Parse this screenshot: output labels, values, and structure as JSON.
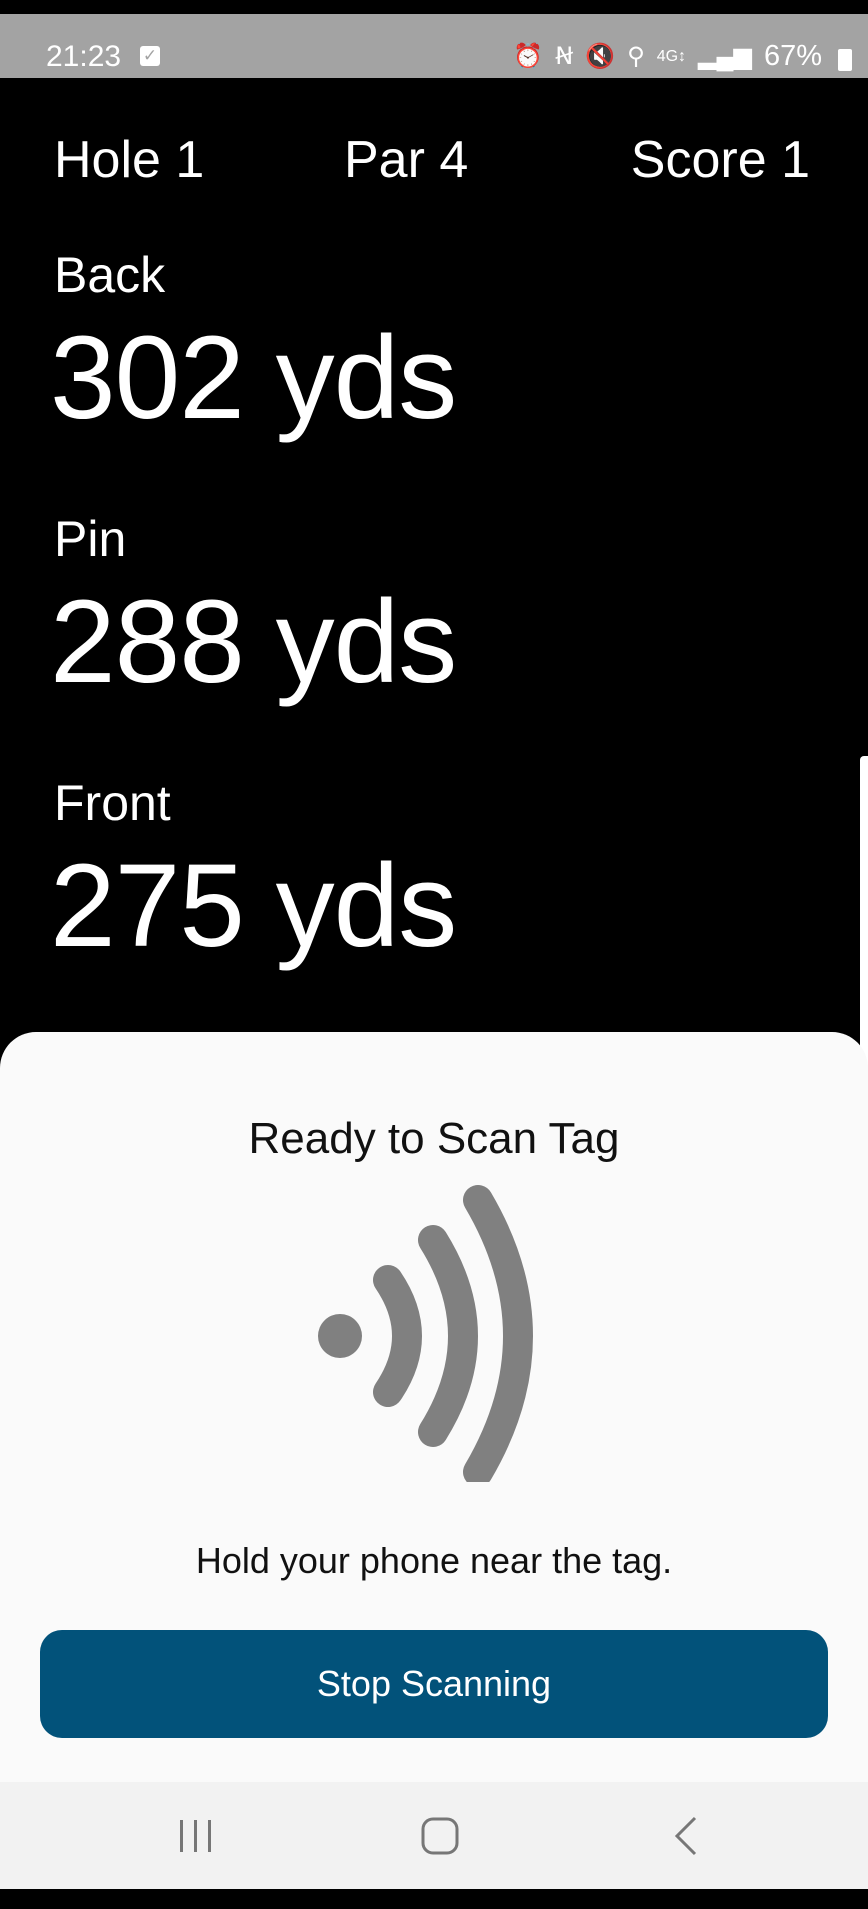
{
  "status_bar": {
    "time": "21:23",
    "battery": "67%",
    "icons": [
      "check-icon",
      "alarm-icon",
      "nfc-icon",
      "mute-icon",
      "location-icon",
      "data-icon",
      "signal-icon",
      "battery-icon"
    ]
  },
  "hole_info": {
    "hole": "Hole 1",
    "par": "Par 4",
    "score": "Score 1"
  },
  "distances": [
    {
      "label": "Back",
      "value": "302 yds"
    },
    {
      "label": "Pin",
      "value": "288 yds"
    },
    {
      "label": "Front",
      "value": "275 yds"
    }
  ],
  "scan_sheet": {
    "title": "Ready to Scan Tag",
    "message": "Hold your phone near the tag.",
    "button": "Stop Scanning",
    "icon": "nfc-wave-icon",
    "button_color": "#02527a",
    "icon_color": "#808080"
  },
  "nav_bar": {
    "buttons": [
      "recent-apps-icon",
      "home-icon",
      "back-icon"
    ]
  }
}
